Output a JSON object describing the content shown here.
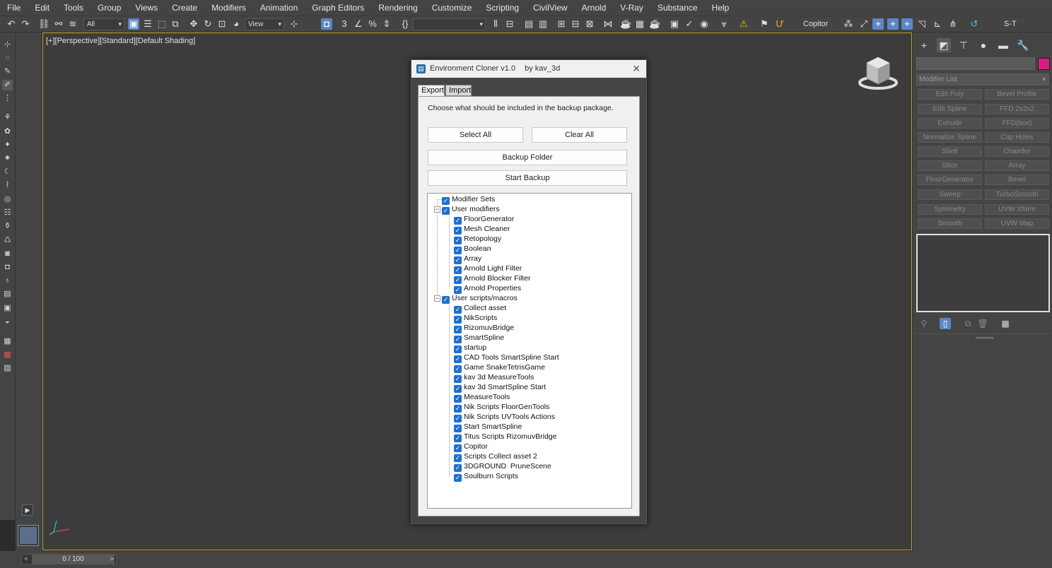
{
  "menu": [
    "File",
    "Edit",
    "Tools",
    "Group",
    "Views",
    "Create",
    "Modifiers",
    "Animation",
    "Graph Editors",
    "Rendering",
    "Customize",
    "Scripting",
    "CivilView",
    "Arnold",
    "V-Ray",
    "Substance",
    "Help"
  ],
  "toolbar": {
    "selection_filter": "All",
    "ref_coord": "View",
    "named_set": "",
    "script_label": "Copitor",
    "layer_label": "S-T"
  },
  "viewport": {
    "label": "[+][Perspective][Standard][Default Shading]"
  },
  "timeline": {
    "frame": "0 / 100",
    "prev": "<",
    "next": ">"
  },
  "command_panel": {
    "modifier_list_label": "Modifier List",
    "modifier_buttons": [
      "Edit Poly",
      "Bevel Profile",
      "Edit Spline",
      "FFD 2x2x2",
      "Extrude",
      "FFD(box)",
      "Normalize Spline",
      "Cap Holes",
      "Shell",
      "Chamfer",
      "Slice",
      "Array",
      "FloorGenerator",
      "Bevel",
      "Sweep",
      "TurboSmooth",
      "Symmetry",
      "UVW Xform",
      "Smooth",
      "UVW Map"
    ],
    "name_color": "#d61d8a"
  },
  "dialog": {
    "title": "Environment Cloner v1.0",
    "author": "by kav_3d",
    "tabs": [
      "Export",
      "Import"
    ],
    "prompt": "Choose what should be included in the backup package.",
    "select_all": "Select All",
    "clear_all": "Clear All",
    "backup_folder": "Backup Folder",
    "start_backup": "Start Backup",
    "tree": {
      "root": "Modifier Sets",
      "groups": [
        {
          "label": "User modifiers",
          "items": [
            "FloorGenerator",
            "Mesh Cleaner",
            "Retopology",
            "Boolean",
            "Array",
            "Arnold Light Filter",
            "Arnold Blocker Filter",
            "Arnold Properties"
          ]
        },
        {
          "label": "User scripts/macros",
          "items": [
            "Collect asset",
            "NikScripts",
            "RizomuvBridge",
            "SmartSpline",
            "startup",
            "CAD Tools SmartSpline Start",
            "Game SnakeTetrisGame",
            "kav 3d MeasureTools",
            "kav 3d SmartSpline Start",
            "MeasureTools",
            "Nik Scripts FloorGenTools",
            "Nik Scripts UVTools Actions",
            "Start SmartSpline",
            "Titus Scripts RizomuvBridge",
            "Copitor",
            "Scripts Collect asset 2",
            "3DGROUND  PruneScene",
            "Soulburn Scripts"
          ]
        }
      ]
    }
  }
}
